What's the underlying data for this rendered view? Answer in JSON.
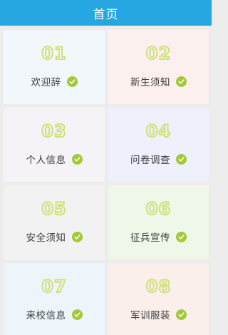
{
  "header": {
    "title": "首页"
  },
  "colors": {
    "header": "#27a7e2",
    "check": "#a4c83a",
    "number_outline": "#cfe07a"
  },
  "items": [
    {
      "number": "01",
      "label": "欢迎辞",
      "bg": "#f1f7fb",
      "icon": "check-icon"
    },
    {
      "number": "02",
      "label": "新生须知",
      "bg": "#fbf0ee",
      "icon": "check-icon"
    },
    {
      "number": "03",
      "label": "个人信息",
      "bg": "#f5f3f8",
      "icon": "check-icon"
    },
    {
      "number": "04",
      "label": "问卷调查",
      "bg": "#eef0fb",
      "icon": "check-icon"
    },
    {
      "number": "05",
      "label": "安全须知",
      "bg": "#f2f2f2",
      "icon": "check-icon"
    },
    {
      "number": "06",
      "label": "征兵宣传",
      "bg": "#eef7e8",
      "icon": "check-icon"
    },
    {
      "number": "07",
      "label": "来校信息",
      "bg": "#edf5fb",
      "icon": "check-icon"
    },
    {
      "number": "08",
      "label": "军训服装",
      "bg": "#fbefec",
      "icon": "check-icon"
    }
  ]
}
